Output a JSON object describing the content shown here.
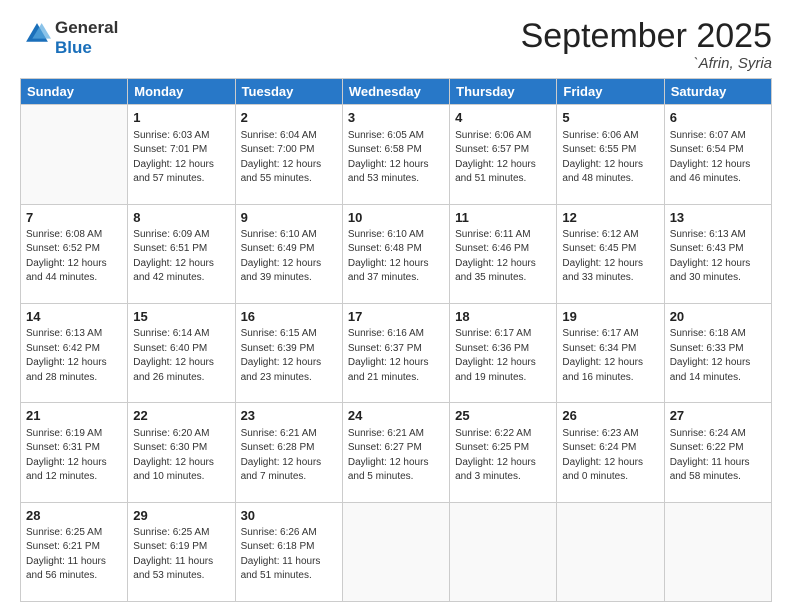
{
  "header": {
    "logo_general": "General",
    "logo_blue": "Blue",
    "month_title": "September 2025",
    "location": "`Afrin, Syria"
  },
  "days_of_week": [
    "Sunday",
    "Monday",
    "Tuesday",
    "Wednesday",
    "Thursday",
    "Friday",
    "Saturday"
  ],
  "weeks": [
    [
      {
        "day": "",
        "sunrise": "",
        "sunset": "",
        "daylight": ""
      },
      {
        "day": "1",
        "sunrise": "6:03 AM",
        "sunset": "7:01 PM",
        "daylight": "12 hours and 57 minutes."
      },
      {
        "day": "2",
        "sunrise": "6:04 AM",
        "sunset": "7:00 PM",
        "daylight": "12 hours and 55 minutes."
      },
      {
        "day": "3",
        "sunrise": "6:05 AM",
        "sunset": "6:58 PM",
        "daylight": "12 hours and 53 minutes."
      },
      {
        "day": "4",
        "sunrise": "6:06 AM",
        "sunset": "6:57 PM",
        "daylight": "12 hours and 51 minutes."
      },
      {
        "day": "5",
        "sunrise": "6:06 AM",
        "sunset": "6:55 PM",
        "daylight": "12 hours and 48 minutes."
      },
      {
        "day": "6",
        "sunrise": "6:07 AM",
        "sunset": "6:54 PM",
        "daylight": "12 hours and 46 minutes."
      }
    ],
    [
      {
        "day": "7",
        "sunrise": "6:08 AM",
        "sunset": "6:52 PM",
        "daylight": "12 hours and 44 minutes."
      },
      {
        "day": "8",
        "sunrise": "6:09 AM",
        "sunset": "6:51 PM",
        "daylight": "12 hours and 42 minutes."
      },
      {
        "day": "9",
        "sunrise": "6:10 AM",
        "sunset": "6:49 PM",
        "daylight": "12 hours and 39 minutes."
      },
      {
        "day": "10",
        "sunrise": "6:10 AM",
        "sunset": "6:48 PM",
        "daylight": "12 hours and 37 minutes."
      },
      {
        "day": "11",
        "sunrise": "6:11 AM",
        "sunset": "6:46 PM",
        "daylight": "12 hours and 35 minutes."
      },
      {
        "day": "12",
        "sunrise": "6:12 AM",
        "sunset": "6:45 PM",
        "daylight": "12 hours and 33 minutes."
      },
      {
        "day": "13",
        "sunrise": "6:13 AM",
        "sunset": "6:43 PM",
        "daylight": "12 hours and 30 minutes."
      }
    ],
    [
      {
        "day": "14",
        "sunrise": "6:13 AM",
        "sunset": "6:42 PM",
        "daylight": "12 hours and 28 minutes."
      },
      {
        "day": "15",
        "sunrise": "6:14 AM",
        "sunset": "6:40 PM",
        "daylight": "12 hours and 26 minutes."
      },
      {
        "day": "16",
        "sunrise": "6:15 AM",
        "sunset": "6:39 PM",
        "daylight": "12 hours and 23 minutes."
      },
      {
        "day": "17",
        "sunrise": "6:16 AM",
        "sunset": "6:37 PM",
        "daylight": "12 hours and 21 minutes."
      },
      {
        "day": "18",
        "sunrise": "6:17 AM",
        "sunset": "6:36 PM",
        "daylight": "12 hours and 19 minutes."
      },
      {
        "day": "19",
        "sunrise": "6:17 AM",
        "sunset": "6:34 PM",
        "daylight": "12 hours and 16 minutes."
      },
      {
        "day": "20",
        "sunrise": "6:18 AM",
        "sunset": "6:33 PM",
        "daylight": "12 hours and 14 minutes."
      }
    ],
    [
      {
        "day": "21",
        "sunrise": "6:19 AM",
        "sunset": "6:31 PM",
        "daylight": "12 hours and 12 minutes."
      },
      {
        "day": "22",
        "sunrise": "6:20 AM",
        "sunset": "6:30 PM",
        "daylight": "12 hours and 10 minutes."
      },
      {
        "day": "23",
        "sunrise": "6:21 AM",
        "sunset": "6:28 PM",
        "daylight": "12 hours and 7 minutes."
      },
      {
        "day": "24",
        "sunrise": "6:21 AM",
        "sunset": "6:27 PM",
        "daylight": "12 hours and 5 minutes."
      },
      {
        "day": "25",
        "sunrise": "6:22 AM",
        "sunset": "6:25 PM",
        "daylight": "12 hours and 3 minutes."
      },
      {
        "day": "26",
        "sunrise": "6:23 AM",
        "sunset": "6:24 PM",
        "daylight": "12 hours and 0 minutes."
      },
      {
        "day": "27",
        "sunrise": "6:24 AM",
        "sunset": "6:22 PM",
        "daylight": "11 hours and 58 minutes."
      }
    ],
    [
      {
        "day": "28",
        "sunrise": "6:25 AM",
        "sunset": "6:21 PM",
        "daylight": "11 hours and 56 minutes."
      },
      {
        "day": "29",
        "sunrise": "6:25 AM",
        "sunset": "6:19 PM",
        "daylight": "11 hours and 53 minutes."
      },
      {
        "day": "30",
        "sunrise": "6:26 AM",
        "sunset": "6:18 PM",
        "daylight": "11 hours and 51 minutes."
      },
      {
        "day": "",
        "sunrise": "",
        "sunset": "",
        "daylight": ""
      },
      {
        "day": "",
        "sunrise": "",
        "sunset": "",
        "daylight": ""
      },
      {
        "day": "",
        "sunrise": "",
        "sunset": "",
        "daylight": ""
      },
      {
        "day": "",
        "sunrise": "",
        "sunset": "",
        "daylight": ""
      }
    ]
  ]
}
